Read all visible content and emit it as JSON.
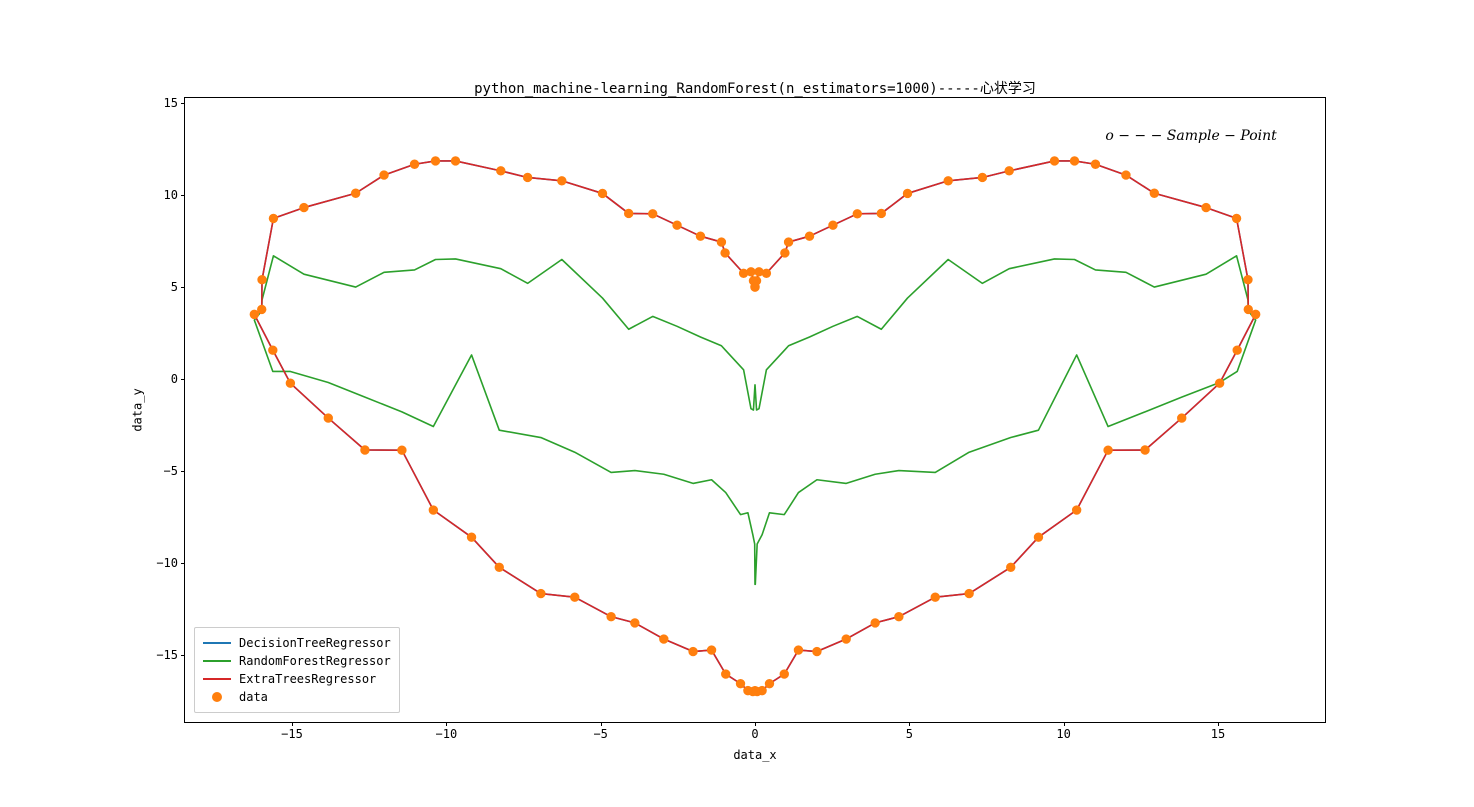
{
  "chart_data": {
    "type": "line",
    "title": "python_machine-learning_RandomForest(n_estimators=1000)-----心状学习",
    "xlabel": "data_x",
    "ylabel": "data_y",
    "xlim": [
      -18.5,
      18.5
    ],
    "ylim": [
      -18.7,
      15.3
    ],
    "xticks": [
      -15,
      -10,
      -5,
      0,
      5,
      10,
      15
    ],
    "yticks": [
      -15,
      -10,
      -5,
      0,
      5,
      10,
      15
    ],
    "legend_position": "lower left",
    "annotation": {
      "text": "o − − − Sample − Point",
      "x": 12,
      "y": 13.2
    },
    "series": [
      {
        "name": "DecisionTreeRegressor",
        "color": "#1f77b4",
        "x": [
          0.0,
          0.05,
          0.13,
          0.37,
          0.97,
          1.09,
          1.77,
          2.53,
          3.32,
          4.1,
          4.95,
          6.27,
          7.38,
          8.25,
          9.72,
          10.37,
          11.05,
          12.04,
          12.96,
          14.64,
          15.63,
          16.0,
          16.01,
          16.25,
          15.65,
          15.08,
          13.85,
          12.66,
          11.46,
          10.44,
          9.2,
          8.3,
          6.95,
          5.85,
          4.67,
          3.9,
          2.96,
          2.01,
          1.41,
          0.95,
          0.47,
          0.23,
          0.07,
          0.01,
          0.0,
          -0.01,
          -0.07,
          -0.23,
          -0.47,
          -0.95,
          -1.41,
          -2.01,
          -2.96,
          -3.9,
          -4.67,
          -5.85,
          -6.95,
          -8.3,
          -9.2,
          -10.44,
          -11.46,
          -12.66,
          -13.85,
          -15.08,
          -15.65,
          -16.25,
          -16.01,
          -16.0,
          -15.63,
          -14.64,
          -12.96,
          -12.04,
          -11.05,
          -10.37,
          -9.72,
          -8.25,
          -7.38,
          -6.27,
          -4.95,
          -4.1,
          -3.32,
          -2.53,
          -1.77,
          -1.09,
          -0.97,
          -0.37,
          -0.13,
          -0.05,
          0.0
        ],
        "y": [
          5.0,
          5.34,
          5.83,
          5.75,
          6.86,
          7.45,
          7.77,
          8.37,
          8.99,
          9.01,
          10.1,
          10.79,
          10.97,
          11.33,
          11.87,
          11.87,
          11.69,
          11.1,
          10.11,
          9.33,
          8.74,
          5.4,
          3.78,
          3.51,
          1.56,
          -0.24,
          -2.14,
          -3.88,
          -3.89,
          -7.15,
          -8.63,
          -10.27,
          -11.7,
          -11.9,
          -12.96,
          -13.3,
          -14.18,
          -14.86,
          -14.78,
          -16.09,
          -16.61,
          -16.99,
          -17.04,
          -17.0,
          -17.0,
          -17.0,
          -17.04,
          -16.99,
          -16.61,
          -16.09,
          -14.78,
          -14.86,
          -14.18,
          -13.3,
          -12.96,
          -11.9,
          -11.7,
          -10.27,
          -8.63,
          -7.15,
          -3.89,
          -3.88,
          -2.14,
          -0.24,
          1.56,
          3.51,
          3.78,
          5.4,
          8.74,
          9.33,
          10.11,
          11.1,
          11.69,
          11.87,
          11.87,
          11.33,
          10.97,
          10.79,
          10.1,
          9.01,
          8.99,
          8.37,
          7.77,
          7.45,
          6.86,
          5.75,
          5.83,
          5.34,
          5.0
        ]
      },
      {
        "name": "RandomForestRegressor",
        "color": "#2ca02c",
        "x": [
          0.0,
          0.05,
          0.13,
          0.37,
          0.97,
          1.09,
          1.77,
          2.53,
          3.32,
          4.1,
          4.95,
          6.27,
          7.38,
          8.25,
          9.72,
          10.37,
          11.05,
          12.04,
          12.96,
          14.64,
          15.63,
          16.0,
          16.01,
          16.25,
          15.65,
          15.65,
          15.08,
          13.85,
          12.66,
          11.46,
          10.44,
          9.2,
          8.3,
          6.95,
          5.85,
          4.67,
          3.9,
          2.96,
          2.01,
          1.41,
          0.95,
          0.47,
          0.23,
          0.07,
          0.01,
          0.0,
          -0.01,
          -0.07,
          -0.23,
          -0.47,
          -0.95,
          -1.41,
          -2.01,
          -2.96,
          -3.9,
          -4.67,
          -5.85,
          -6.95,
          -8.3,
          -9.2,
          -10.44,
          -11.46,
          -12.66,
          -13.85,
          -15.08,
          -15.65,
          -16.25,
          -16.01,
          -16.0,
          -15.63,
          -14.64,
          -12.96,
          -12.04,
          -11.05,
          -10.37,
          -9.72,
          -8.25,
          -7.38,
          -6.27,
          -4.95,
          -4.1,
          -3.32,
          -2.53,
          -1.77,
          -1.09,
          -0.97,
          -0.37,
          -0.13,
          -0.05,
          0.0
        ],
        "y": [
          -0.3,
          -1.7,
          -1.63,
          0.49,
          1.58,
          1.8,
          2.28,
          2.86,
          3.4,
          2.7,
          4.4,
          6.5,
          5.2,
          6.0,
          6.53,
          6.5,
          5.93,
          5.8,
          5.0,
          5.7,
          6.7,
          4.3,
          3.7,
          3.2,
          0.4,
          0.4,
          -0.2,
          -1.0,
          -1.8,
          -2.6,
          1.3,
          -2.8,
          -3.2,
          -4.0,
          -5.1,
          -5.0,
          -5.2,
          -5.7,
          -5.5,
          -6.2,
          -7.4,
          -7.3,
          -8.5,
          -9.0,
          -11.2,
          -11.2,
          -9.0,
          -8.5,
          -7.3,
          -7.4,
          -6.2,
          -5.5,
          -5.7,
          -5.2,
          -5.0,
          -5.1,
          -4.0,
          -3.2,
          -2.8,
          1.3,
          -2.6,
          -1.8,
          -1.0,
          -0.2,
          0.4,
          0.4,
          3.2,
          3.7,
          4.3,
          6.7,
          5.7,
          5.0,
          5.8,
          5.93,
          6.5,
          6.53,
          6.0,
          5.2,
          6.5,
          4.4,
          2.7,
          3.4,
          2.86,
          2.28,
          1.8,
          1.58,
          0.49,
          -1.63,
          -1.7,
          -0.3
        ]
      },
      {
        "name": "ExtraTreesRegressor",
        "color": "#d62728",
        "x": [
          0.0,
          0.05,
          0.13,
          0.37,
          0.97,
          1.09,
          1.77,
          2.53,
          3.32,
          4.1,
          4.95,
          6.27,
          7.38,
          8.25,
          9.72,
          10.37,
          11.05,
          12.04,
          12.96,
          14.64,
          15.63,
          16.0,
          16.01,
          16.25,
          15.65,
          15.08,
          13.85,
          12.66,
          11.46,
          10.44,
          9.2,
          8.3,
          6.95,
          5.85,
          4.67,
          3.9,
          2.96,
          2.01,
          1.41,
          0.95,
          0.47,
          0.23,
          0.07,
          0.01,
          0.0,
          -0.01,
          -0.07,
          -0.23,
          -0.47,
          -0.95,
          -1.41,
          -2.01,
          -2.96,
          -3.9,
          -4.67,
          -5.85,
          -6.95,
          -8.3,
          -9.2,
          -10.44,
          -11.46,
          -12.66,
          -13.85,
          -15.08,
          -15.65,
          -16.25,
          -16.01,
          -16.0,
          -15.63,
          -14.64,
          -12.96,
          -12.04,
          -11.05,
          -10.37,
          -9.72,
          -8.25,
          -7.38,
          -6.27,
          -4.95,
          -4.1,
          -3.32,
          -2.53,
          -1.77,
          -1.09,
          -0.97,
          -0.37,
          -0.13,
          -0.05,
          0.0
        ],
        "y": [
          5.0,
          5.34,
          5.83,
          5.75,
          6.86,
          7.45,
          7.77,
          8.37,
          8.99,
          9.01,
          10.1,
          10.79,
          10.97,
          11.33,
          11.87,
          11.87,
          11.69,
          11.1,
          10.11,
          9.33,
          8.74,
          5.4,
          3.78,
          3.51,
          1.56,
          -0.24,
          -2.14,
          -3.88,
          -3.89,
          -7.15,
          -8.63,
          -10.27,
          -11.7,
          -11.9,
          -12.96,
          -13.3,
          -14.18,
          -14.86,
          -14.78,
          -16.09,
          -16.61,
          -16.99,
          -17.04,
          -17.0,
          -17.0,
          -17.0,
          -17.04,
          -16.99,
          -16.61,
          -16.09,
          -14.78,
          -14.86,
          -14.18,
          -13.3,
          -12.96,
          -11.9,
          -11.7,
          -10.27,
          -8.63,
          -7.15,
          -3.89,
          -3.88,
          -2.14,
          -0.24,
          1.56,
          3.51,
          3.78,
          5.4,
          8.74,
          9.33,
          10.11,
          11.1,
          11.69,
          11.87,
          11.87,
          11.33,
          10.97,
          10.79,
          10.1,
          9.01,
          8.99,
          8.37,
          7.77,
          7.45,
          6.86,
          5.75,
          5.83,
          5.34,
          5.0
        ]
      }
    ],
    "scatter": {
      "name": "data",
      "color": "#ff7f0e",
      "x": [
        0.0,
        0.05,
        0.13,
        0.37,
        0.97,
        1.09,
        1.77,
        2.53,
        3.32,
        4.1,
        4.95,
        6.27,
        7.38,
        8.25,
        9.72,
        10.37,
        11.05,
        12.04,
        12.96,
        14.64,
        15.63,
        16.0,
        16.01,
        16.25,
        15.65,
        15.08,
        13.85,
        12.66,
        11.46,
        10.44,
        9.2,
        8.3,
        6.95,
        5.85,
        4.67,
        3.9,
        2.96,
        2.01,
        1.41,
        0.95,
        0.47,
        0.23,
        0.07,
        0.01,
        0.0,
        -0.01,
        -0.07,
        -0.23,
        -0.47,
        -0.95,
        -1.41,
        -2.01,
        -2.96,
        -3.9,
        -4.67,
        -5.85,
        -6.95,
        -8.3,
        -9.2,
        -10.44,
        -11.46,
        -12.66,
        -13.85,
        -15.08,
        -15.65,
        -16.25,
        -16.01,
        -16.0,
        -15.63,
        -14.64,
        -12.96,
        -12.04,
        -11.05,
        -10.37,
        -9.72,
        -8.25,
        -7.38,
        -6.27,
        -4.95,
        -4.1,
        -3.32,
        -2.53,
        -1.77,
        -1.09,
        -0.97,
        -0.37,
        -0.13,
        -0.05,
        0.0
      ],
      "y": [
        5.0,
        5.34,
        5.83,
        5.75,
        6.86,
        7.45,
        7.77,
        8.37,
        8.99,
        9.01,
        10.1,
        10.79,
        10.97,
        11.33,
        11.87,
        11.87,
        11.69,
        11.1,
        10.11,
        9.33,
        8.74,
        5.4,
        3.78,
        3.51,
        1.56,
        -0.24,
        -2.14,
        -3.88,
        -3.89,
        -7.15,
        -8.63,
        -10.27,
        -11.7,
        -11.9,
        -12.96,
        -13.3,
        -14.18,
        -14.86,
        -14.78,
        -16.09,
        -16.61,
        -16.99,
        -17.04,
        -17.0,
        -17.0,
        -17.0,
        -17.04,
        -16.99,
        -16.61,
        -16.09,
        -14.78,
        -14.86,
        -14.18,
        -13.3,
        -12.96,
        -11.9,
        -11.7,
        -10.27,
        -8.63,
        -7.15,
        -3.89,
        -3.88,
        -2.14,
        -0.24,
        1.56,
        3.51,
        3.78,
        5.4,
        8.74,
        9.33,
        10.11,
        11.1,
        11.69,
        11.87,
        11.87,
        11.33,
        10.97,
        10.79,
        10.1,
        9.01,
        8.99,
        8.37,
        7.77,
        7.45,
        6.86,
        5.75,
        5.83,
        5.34,
        5.0
      ]
    },
    "legend_entries": [
      {
        "label": "DecisionTreeRegressor",
        "type": "line",
        "color": "#1f77b4"
      },
      {
        "label": "RandomForestRegressor",
        "type": "line",
        "color": "#2ca02c"
      },
      {
        "label": "ExtraTreesRegressor",
        "type": "line",
        "color": "#d62728"
      },
      {
        "label": "data",
        "type": "marker",
        "color": "#ff7f0e"
      }
    ]
  }
}
